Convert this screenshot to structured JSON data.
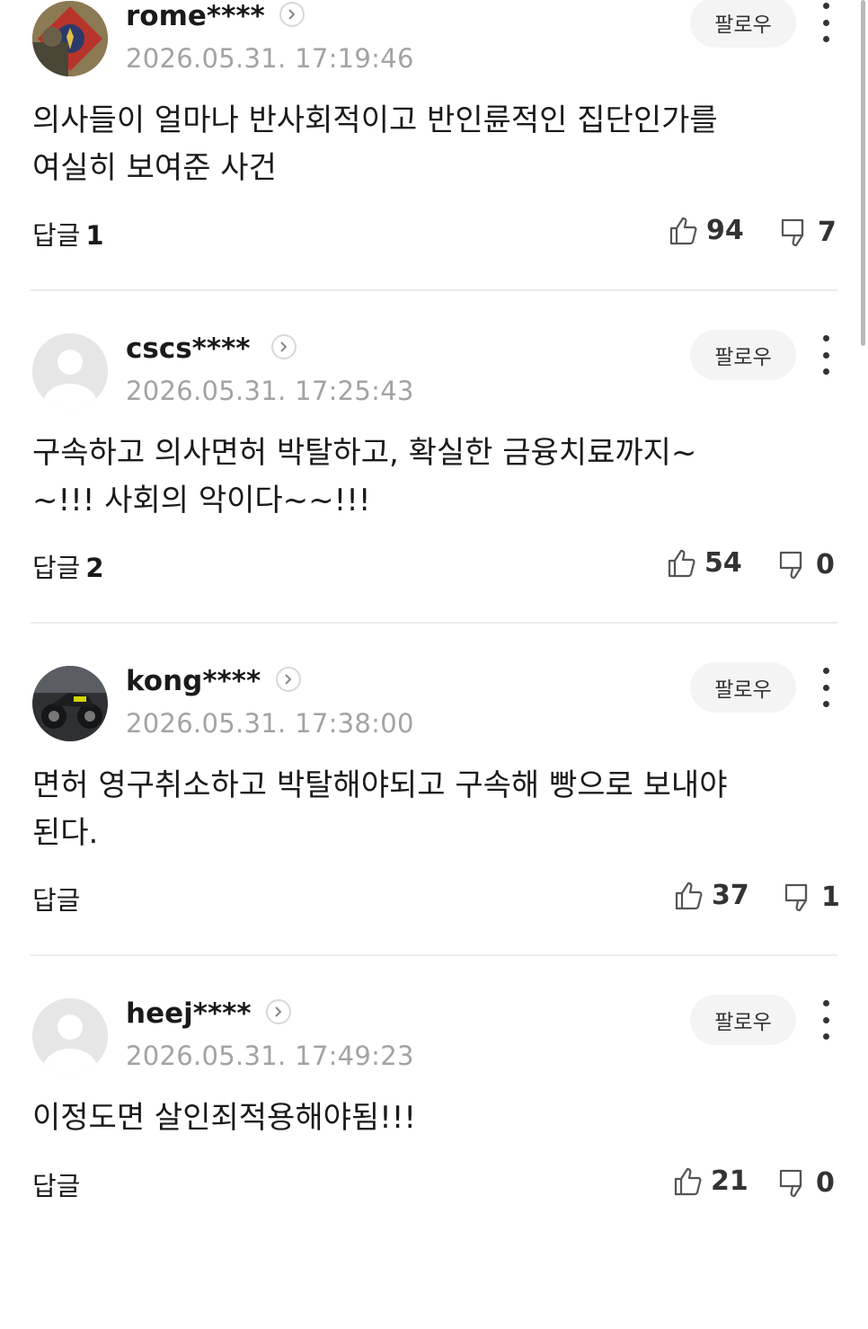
{
  "follow_label": "팔로우",
  "comments": [
    {
      "nickname": "rome****",
      "datetime": "2026.05.31. 17:19:46",
      "text_lines": [
        "의사들이 얼마나 반사회적이고 반인륜적인 집단인가를",
        "여실히 보여준 사건"
      ],
      "reply_label": "답글",
      "reply_count": "1",
      "likes": "94",
      "dislikes": "7",
      "avatar": "military-emblem-photo"
    },
    {
      "nickname": "cscs****",
      "datetime": "2026.05.31. 17:25:43",
      "text_lines": [
        "구속하고 의사면허 박탈하고, 확실한 금융치료까지~",
        "~!!! 사회의 악이다~~!!!"
      ],
      "reply_label": "답글",
      "reply_count": "2",
      "likes": "54",
      "dislikes": "0",
      "avatar": "default-user"
    },
    {
      "nickname": "kong****",
      "datetime": "2026.05.31. 17:38:00",
      "text_lines": [
        "면허 영구취소하고 박탈해야되고 구속해 빵으로 보내야",
        "된다."
      ],
      "reply_label": "답글",
      "reply_count": "",
      "likes": "37",
      "dislikes": "1",
      "avatar": "motorcycle-photo"
    },
    {
      "nickname": "heej****",
      "datetime": "2026.05.31. 17:49:23",
      "text_lines": [
        "이정도면 살인죄적용해야됨!!!"
      ],
      "reply_label": "답글",
      "reply_count": "",
      "likes": "21",
      "dislikes": "0",
      "avatar": "default-user"
    }
  ]
}
